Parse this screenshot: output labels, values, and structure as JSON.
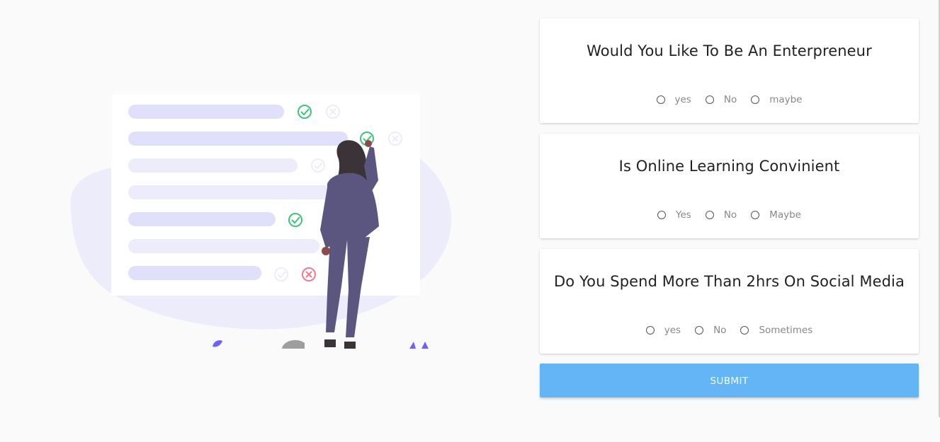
{
  "questions": [
    {
      "text": "Would You Like To Be An Enterpreneur",
      "options": [
        "yes",
        "No",
        "maybe"
      ]
    },
    {
      "text": "Is Online Learning Convinient",
      "options": [
        "Yes",
        "No",
        "Maybe"
      ]
    },
    {
      "text": "Do You Spend More Than 2hrs On Social Media",
      "options": [
        "yes",
        "No",
        "Sometimes"
      ]
    }
  ],
  "submit_label": "SUBMIT",
  "colors": {
    "submit_bg": "#64b5f6",
    "check_green": "#3ec47a",
    "cross_red": "#f07a90",
    "list_bar": "#e0e0fb",
    "blob": "#ececfa",
    "person_suit": "#5b5680"
  }
}
